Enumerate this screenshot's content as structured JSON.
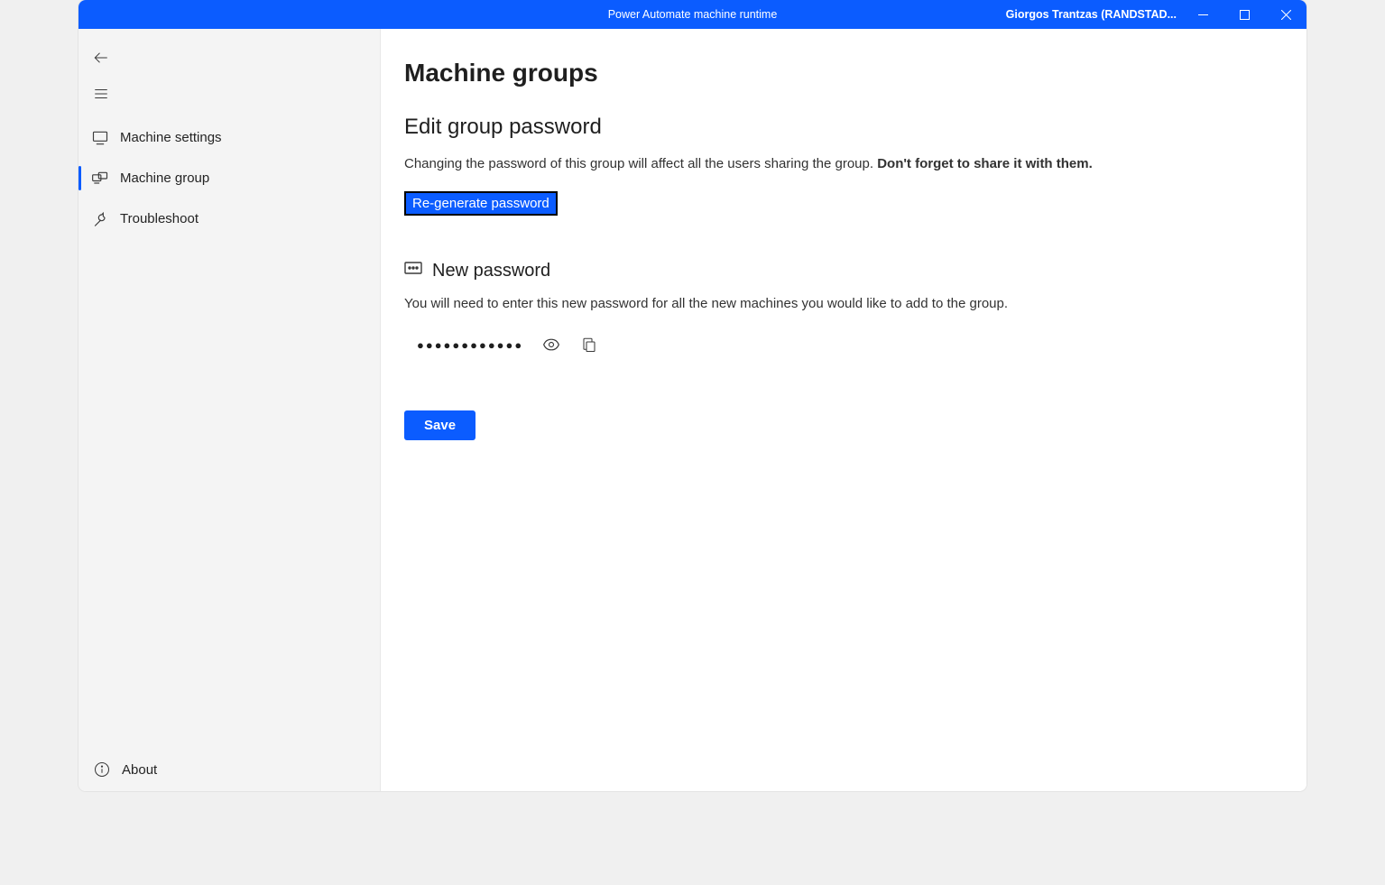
{
  "titlebar": {
    "title": "Power Automate machine runtime",
    "user": "Giorgos Trantzas (RANDSTAD..."
  },
  "sidebar": {
    "items": [
      {
        "label": "Machine settings"
      },
      {
        "label": "Machine group"
      },
      {
        "label": "Troubleshoot"
      }
    ],
    "about": "About"
  },
  "main": {
    "page_title": "Machine groups",
    "section_title": "Edit group password",
    "section_desc_prefix": "Changing the password of this group will affect all the users sharing the group. ",
    "section_desc_bold": "Don't forget to share it with them.",
    "regenerate_label": "Re-generate password",
    "new_pw_label": "New password",
    "new_pw_desc": "You will need to enter this new password for all the new machines you would like to add to the group.",
    "pw_masked": "●●●●●●●●●●●●",
    "save_label": "Save"
  }
}
